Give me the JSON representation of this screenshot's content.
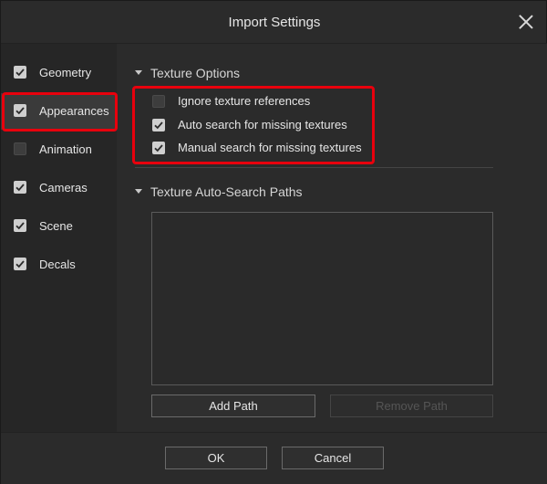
{
  "window": {
    "title": "Import Settings"
  },
  "sidebar": {
    "items": [
      {
        "label": "Geometry",
        "checked": true
      },
      {
        "label": "Appearances",
        "checked": true,
        "selected": true
      },
      {
        "label": "Animation",
        "checked": false
      },
      {
        "label": "Cameras",
        "checked": true
      },
      {
        "label": "Scene",
        "checked": true
      },
      {
        "label": "Decals",
        "checked": true
      }
    ]
  },
  "texture_options": {
    "header": "Texture Options",
    "options": [
      {
        "label": "Ignore texture references",
        "checked": false
      },
      {
        "label": "Auto search for missing textures",
        "checked": true
      },
      {
        "label": "Manual search for missing textures",
        "checked": true
      }
    ]
  },
  "auto_search": {
    "header": "Texture Auto-Search Paths",
    "add_label": "Add Path",
    "remove_label": "Remove Path"
  },
  "footer": {
    "ok_label": "OK",
    "cancel_label": "Cancel"
  },
  "colors": {
    "background": "#2b2b2b",
    "sidebar": "#262626",
    "selected_item": "#3a3a3a",
    "highlight": "#e8000d",
    "text": "#e6e6e6"
  }
}
